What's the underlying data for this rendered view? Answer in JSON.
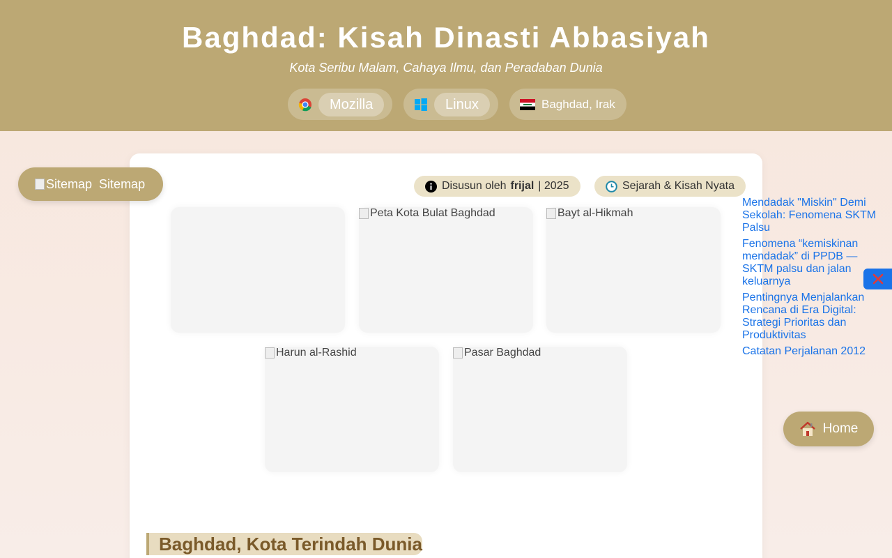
{
  "header": {
    "title": "Baghdad: Kisah Dinasti Abbasiyah",
    "subtitle": "Kota Seribu Malam, Cahaya Ilmu, dan Peradaban Dunia",
    "browser_label": "Mozilla",
    "os_label": "Linux",
    "location_label": "Baghdad, Irak",
    "browser_icon": "chrome-icon",
    "os_icon": "windows-icon",
    "location_icon": "iraq-flag-icon"
  },
  "meta": {
    "author_prefix": "Disusun oleh",
    "author": "frijal",
    "year": "| 2025",
    "category": "Sejarah & Kisah Nyata"
  },
  "gallery": [
    {
      "alt": ""
    },
    {
      "alt": "Peta Kota Bulat Baghdad"
    },
    {
      "alt": "Bayt al-Hikmah"
    },
    {
      "alt": "Harun al-Rashid"
    },
    {
      "alt": "Pasar Baghdad"
    }
  ],
  "section": {
    "heading": "Baghdad, Kota Terindah Dunia"
  },
  "sitemap": {
    "alt": "Sitemap",
    "label": "Sitemap"
  },
  "related": [
    "Mendadak \"Miskin\" Demi Sekolah: Fenomena SKTM Palsu",
    "Fenomena “kemiskinan mendadak” di PPDB — SKTM palsu dan jalan keluarnya",
    "Pentingnya Menjalankan Rencana di Era Digital: Strategi Prioritas dan Produktivitas",
    "Catatan Perjalanan 2012"
  ],
  "home": {
    "label": "Home"
  },
  "colors": {
    "header_bg": "#bca874",
    "link": "#1a73e8",
    "heading_text": "#7a5a2a",
    "close_icon": "#e53935"
  }
}
